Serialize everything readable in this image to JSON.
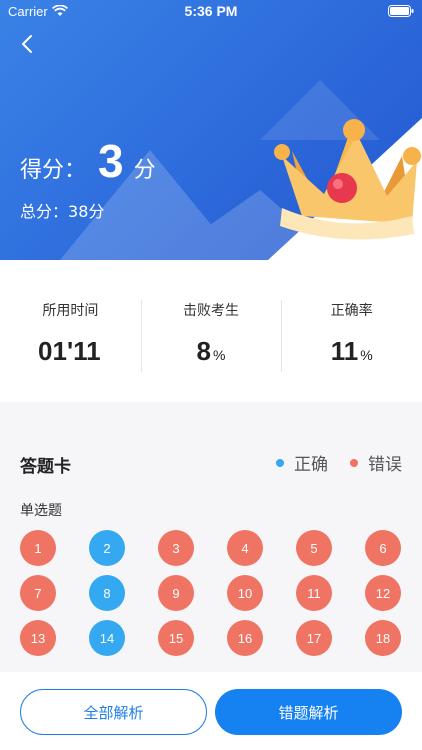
{
  "status_bar": {
    "carrier": "Carrier",
    "time": "5:36 PM"
  },
  "header": {
    "score_label": "得分：",
    "score_value": "3",
    "score_unit": "分",
    "total_label": "总分：",
    "total_value": "38分"
  },
  "stats": [
    {
      "label": "所用时间",
      "value": "01'11",
      "unit": ""
    },
    {
      "label": "击败考生",
      "value": "8",
      "unit": "%"
    },
    {
      "label": "正确率",
      "value": "11",
      "unit": "%"
    }
  ],
  "answer_card": {
    "title": "答题卡",
    "legend": [
      {
        "label": "正确",
        "color": "#34a8f0"
      },
      {
        "label": "错误",
        "color": "#f07463"
      }
    ],
    "section_label": "单选题",
    "questions": [
      {
        "n": "1",
        "status": "wrong"
      },
      {
        "n": "2",
        "status": "correct"
      },
      {
        "n": "3",
        "status": "wrong"
      },
      {
        "n": "4",
        "status": "wrong"
      },
      {
        "n": "5",
        "status": "wrong"
      },
      {
        "n": "6",
        "status": "wrong"
      },
      {
        "n": "7",
        "status": "wrong"
      },
      {
        "n": "8",
        "status": "correct"
      },
      {
        "n": "9",
        "status": "wrong"
      },
      {
        "n": "10",
        "status": "wrong"
      },
      {
        "n": "11",
        "status": "wrong"
      },
      {
        "n": "12",
        "status": "wrong"
      },
      {
        "n": "13",
        "status": "wrong"
      },
      {
        "n": "14",
        "status": "correct"
      },
      {
        "n": "15",
        "status": "wrong"
      },
      {
        "n": "16",
        "status": "wrong"
      },
      {
        "n": "17",
        "status": "wrong"
      },
      {
        "n": "18",
        "status": "wrong"
      }
    ]
  },
  "colors": {
    "correct": "#34a8f0",
    "wrong": "#f07463",
    "primary": "#1681f0"
  },
  "buttons": {
    "all_analysis": "全部解析",
    "wrong_analysis": "错题解析"
  },
  "icons": {
    "back": "chevron-left-icon",
    "crown": "crown-icon",
    "wifi": "wifi-icon",
    "battery": "battery-icon"
  }
}
